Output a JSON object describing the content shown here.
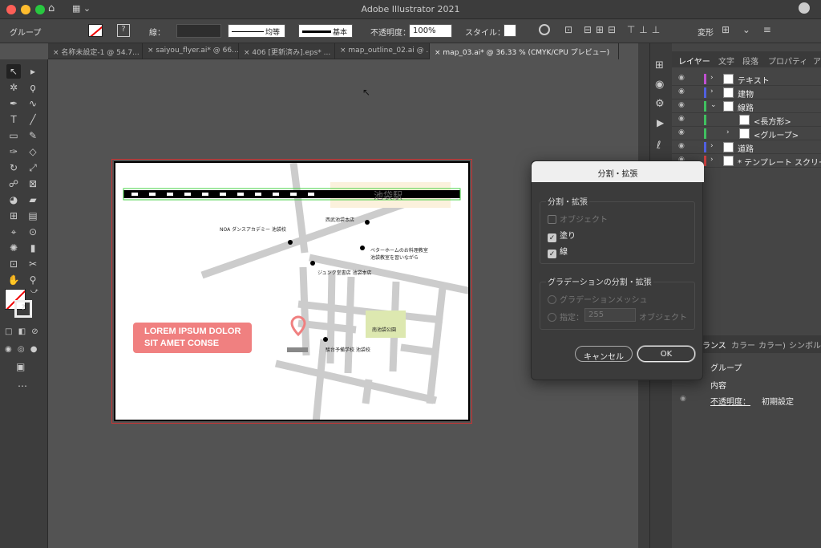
{
  "window": {
    "title": "Adobe Illustrator 2021"
  },
  "control_bar": {
    "selection": "グループ",
    "stroke_label": "線：",
    "line1": "均等",
    "line2": "基本",
    "opacity_label": "不透明度：",
    "opacity_value": "100%",
    "style_label": "スタイル：",
    "transform": "変形"
  },
  "tabs": [
    {
      "label": "名称未設定-1 @ 54.7..."
    },
    {
      "label": "saiyou_flyer.ai* @ 66..."
    },
    {
      "label": "406 [更新済み].eps* ..."
    },
    {
      "label": "map_outline_02.ai @ ..."
    },
    {
      "label": "map_03.ai* @ 36.33 % (CMYK/CPU プレビュー)"
    }
  ],
  "layers_panel": {
    "tabs": [
      "レイヤー",
      "文字",
      "段落",
      "プロパティ",
      "ア"
    ],
    "layers": [
      {
        "name": "テキスト",
        "color": "#c050d0",
        "indent": 0
      },
      {
        "name": "建物",
        "color": "#5060e0",
        "indent": 0
      },
      {
        "name": "線路",
        "color": "#40c060",
        "indent": 0
      },
      {
        "name": "<長方形>",
        "color": "#40c060",
        "indent": 2
      },
      {
        "name": "<グループ>",
        "color": "#40c060",
        "indent": 1
      },
      {
        "name": "道路",
        "color": "#5060e0",
        "indent": 0
      },
      {
        "name": "* テンプレート スクリー",
        "color": "#d04040",
        "indent": 0
      }
    ]
  },
  "appearance_panel": {
    "tabs": [
      "ランス",
      "カラー",
      "カラー)",
      "シンボル"
    ],
    "title": "グループ",
    "content": "内容",
    "opacity_label": "不透明度：",
    "opacity_value": "初期設定"
  },
  "map": {
    "station": "池袋駅",
    "labels": [
      "西武池袋本店",
      "NOA ダンスアカデミー 池袋校",
      "ベターホームのお料理教室",
      "池袋教室を習いながら",
      "ジュンク堂書店 池袋本店",
      "南池袋公園",
      "駿台予備学校 池袋校"
    ],
    "callout_line1": "LOREM IPSUM DOLOR",
    "callout_line2": "SIT AMET CONSE"
  },
  "dialog": {
    "title": "分割・拡張",
    "section1": "分割・拡張",
    "opt_object": "オブジェクト",
    "opt_fill": "塗り",
    "opt_stroke": "線",
    "section2": "グラデーションの分割・拡張",
    "opt_mesh": "グラデーションメッシュ",
    "opt_specify": "指定：",
    "specify_value": "255",
    "specify_unit": "オブジェクト",
    "cancel": "キャンセル",
    "ok": "OK"
  },
  "colors": {
    "accent": "#f08080",
    "park": "#dde8b0",
    "road": "#cccccc"
  }
}
